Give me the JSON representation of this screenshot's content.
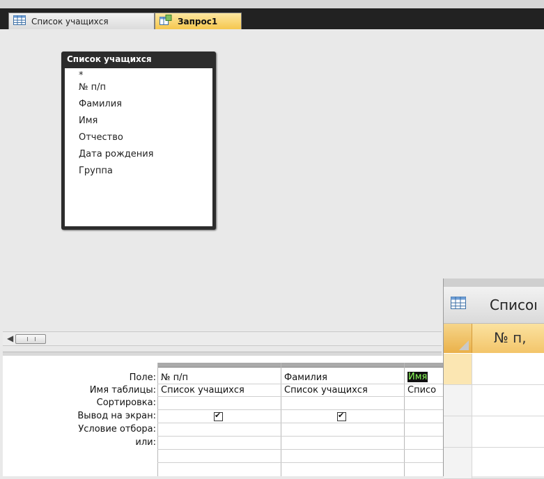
{
  "tabs": [
    {
      "label": "Список учащихся",
      "icon": "table-icon"
    },
    {
      "label": "Запрос1",
      "icon": "query-icon"
    }
  ],
  "field_list": {
    "title": "Список учащихся",
    "fields": [
      "*",
      "№ п/п",
      "Фамилия",
      "Имя",
      "Отчество",
      "Дата рождения",
      "Группа"
    ]
  },
  "qbe": {
    "row_labels": [
      "Поле:",
      "Имя таблицы:",
      "Сортировка:",
      "Вывод на экран:",
      "Условие отбора:",
      "или:"
    ],
    "columns": [
      {
        "field": "№ п/п",
        "table": "Список учащихся",
        "show": true
      },
      {
        "field": "Фамилия",
        "table": "Список учащихся",
        "show": true
      },
      {
        "field": "Имя",
        "table": "Списо",
        "show": false
      }
    ]
  },
  "datasheet_window": {
    "title": "Списоı",
    "column_header": "№ п,"
  }
}
